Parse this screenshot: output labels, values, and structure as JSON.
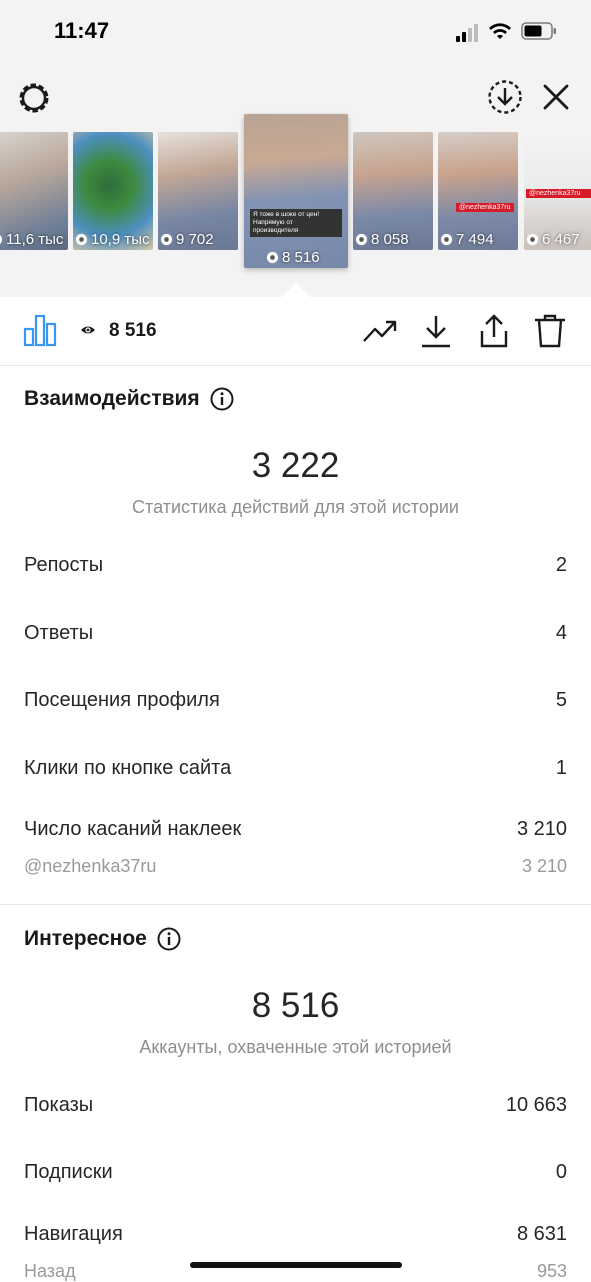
{
  "status_bar": {
    "time": "11:47"
  },
  "stories": [
    {
      "views": "11,6 тыс"
    },
    {
      "views": "10,9 тыс"
    },
    {
      "views": "9 702"
    },
    {
      "views": "8 516",
      "caption": "Я тоже в шоке от цен! Напрямую от производителя"
    },
    {
      "views": "8 058"
    },
    {
      "views": "7 494",
      "tag": "@nezhenka37ru"
    },
    {
      "views": "6 467",
      "tag": "@nezhenka37ru"
    }
  ],
  "header": {
    "views": "8 516"
  },
  "interactions": {
    "title": "Взаимодействия",
    "total": "3 222",
    "subtitle": "Статистика действий для этой истории",
    "rows": [
      {
        "label": "Репосты",
        "value": "2"
      },
      {
        "label": "Ответы",
        "value": "4"
      },
      {
        "label": "Посещения профиля",
        "value": "5"
      },
      {
        "label": "Клики по кнопке сайта",
        "value": "1"
      },
      {
        "label": "Число касаний наклеек",
        "value": "3 210"
      }
    ],
    "sticker": {
      "label": "@nezhenka37ru",
      "value": "3 210"
    }
  },
  "discovery": {
    "title": "Интересное",
    "total": "8 516",
    "subtitle": "Аккаунты, охваченные этой историей",
    "rows": [
      {
        "label": "Показы",
        "value": "10 663"
      },
      {
        "label": "Подписки",
        "value": "0"
      },
      {
        "label": "Навигация",
        "value": "8 631"
      }
    ],
    "nav_sub": {
      "label": "Назад",
      "value": "953"
    }
  },
  "colors": {
    "accent": "#3897f0",
    "muted": "#8e8e8e",
    "tag_red": "#d81b29"
  }
}
